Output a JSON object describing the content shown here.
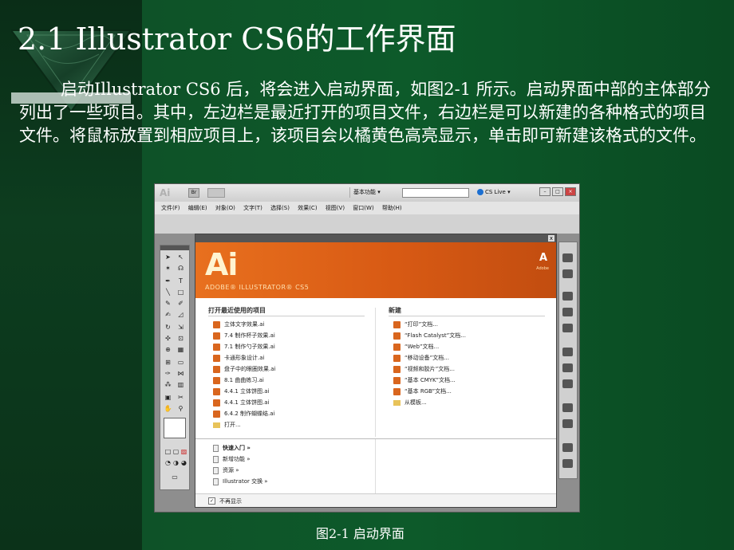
{
  "slide": {
    "title": "2.1   Illustrator CS6的工作界面",
    "paragraph": "启动Illustrator CS6 后，将会进入启动界面，如图2-1 所示。启动界面中部的主体部分列出了一些项目。其中，左边栏是最近打开的项目文件，右边栏是可以新建的各种格式的项目文件。将鼠标放置到相应项目上，该项目会以橘黄色高亮显示，单击即可新建该格式的文件。",
    "caption": "图2-1    启动界面"
  },
  "app": {
    "logo": "Ai",
    "bridge": "Br",
    "workspace": "基本功能 ▾",
    "cslive": "CS Live ▾",
    "menus": [
      "文件(F)",
      "编辑(E)",
      "对象(O)",
      "文字(T)",
      "选择(S)",
      "效果(C)",
      "视图(V)",
      "窗口(W)",
      "帮助(H)"
    ]
  },
  "welcome": {
    "close": "x",
    "banner_logo": "Ai",
    "banner_sub": "ADOBE® ILLUSTRATOR® CS5",
    "adobe_mark": "A",
    "adobe_text": "Adobe",
    "recent_header": "打开最近使用的项目",
    "recent": [
      "立体文字效果.ai",
      "7.4  制作杯子效果.ai",
      "7.1  制作勺子效果.ai",
      "卡通形象设计.ai",
      "盘子中的眼圈效果.ai",
      "8.1  曲曲练习.ai",
      "4.4.1  立体饼图.ai",
      "4.4.1  立体饼图.ai",
      "6.4.2  制作蝴蝶结.ai"
    ],
    "open": "打开...",
    "new_header": "新建",
    "new_items": [
      "“打印”文档...",
      "“Flash Catalyst”文档...",
      "“Web”文档...",
      "“移动设备”文档...",
      "“视频和胶片”文档...",
      "“基本 CMYK”文档...",
      "“基本 RGB”文档..."
    ],
    "from_template": "从模板...",
    "bottom_links": [
      "快速入门 »",
      "新增功能 »",
      "资源 »",
      "Illustrator 交换 »"
    ],
    "dont_show": "不再显示"
  }
}
